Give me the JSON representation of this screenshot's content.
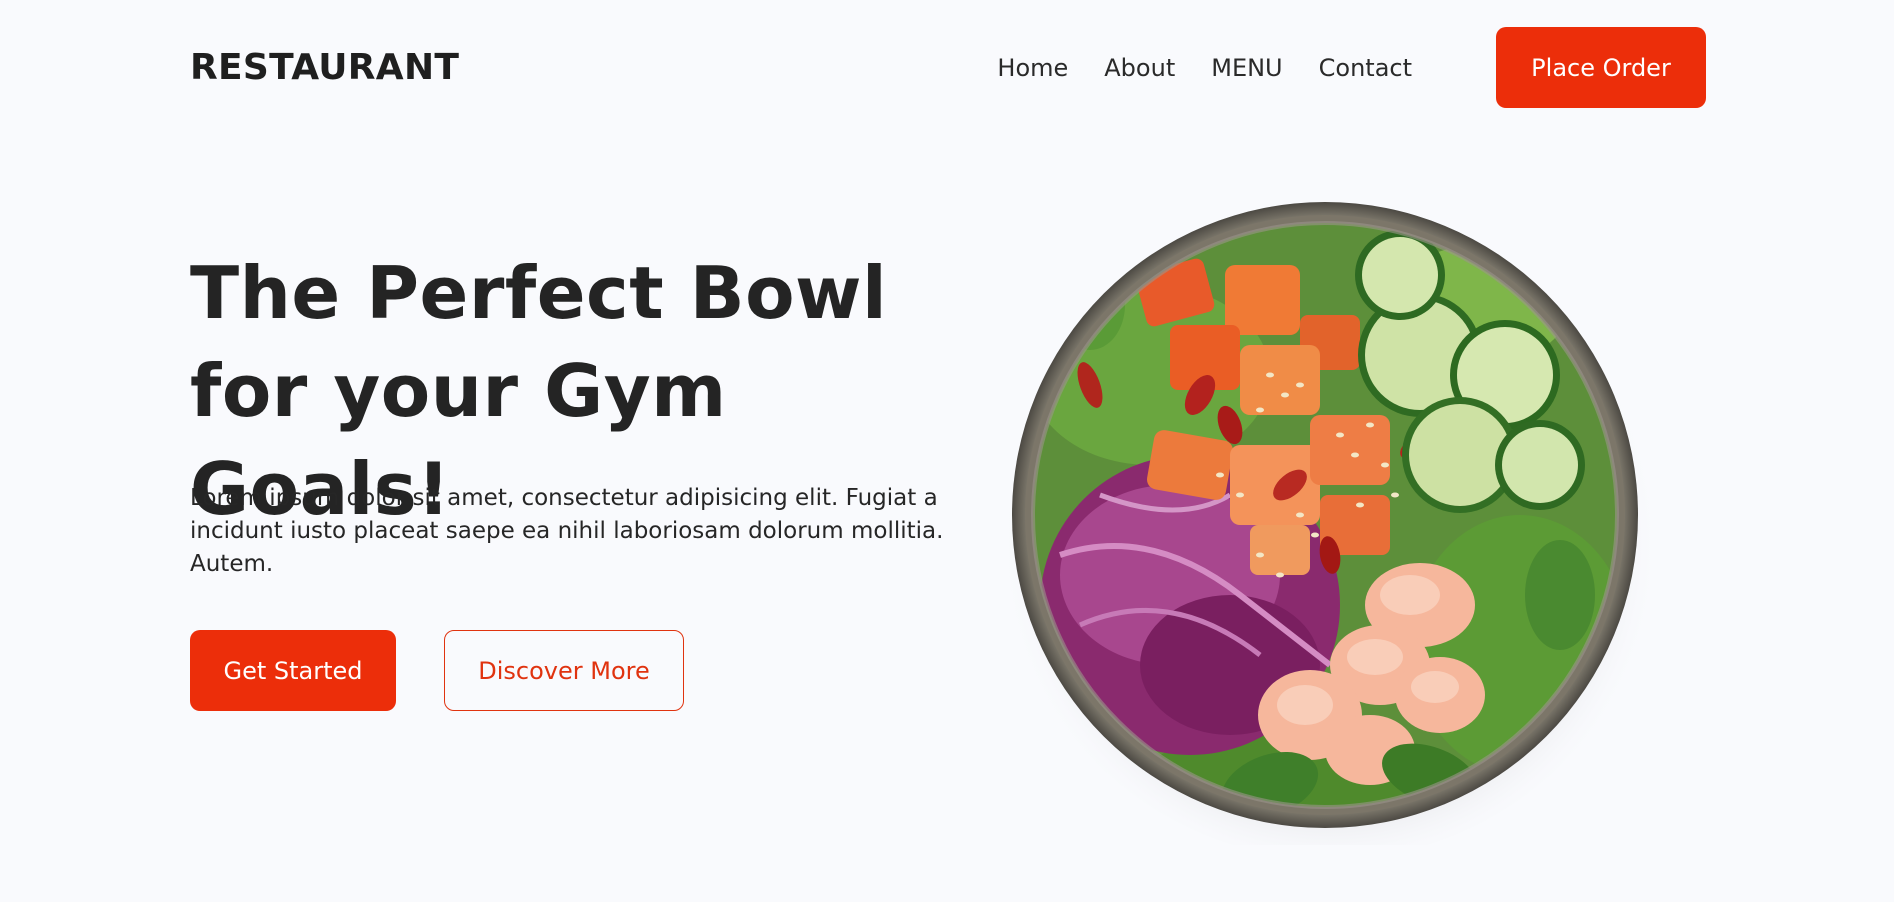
{
  "header": {
    "logo": "RESTAURANT",
    "nav": [
      "Home",
      "About",
      "MENU",
      "Contact"
    ],
    "cta_label": "Place Order"
  },
  "hero": {
    "title": "The Perfect Bowl for your Gym Goals!",
    "description": "Lorem ipsum dolor sit amet, consectetur adipisicing elit. Fugiat a incidunt iusto placeat saepe ea nihil laboriosam dolorum mollitia. Autem.",
    "primary_button": "Get Started",
    "secondary_button": "Discover More"
  },
  "image": {
    "name": "salad-bowl-image"
  },
  "colors": {
    "accent": "#ec2e0a",
    "background": "#f9fafd",
    "text": "#242424"
  }
}
